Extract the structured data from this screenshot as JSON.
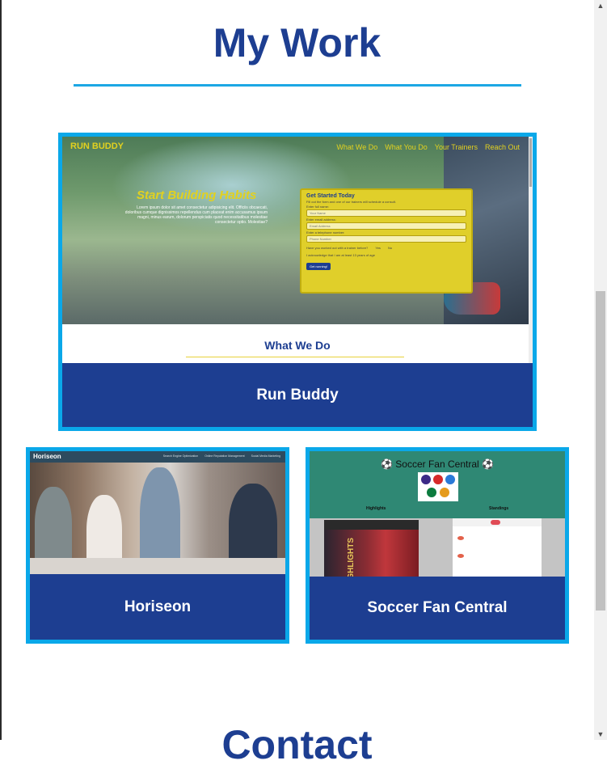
{
  "section": {
    "title": "My Work",
    "next_title": "Contact"
  },
  "colors": {
    "heading": "#1d3e91",
    "accent": "#0aa8e9",
    "card_label_bg": "#1d3e91"
  },
  "projects": [
    {
      "label": "Run Buddy",
      "screenshot": {
        "brand": "RUN BUDDY",
        "nav": [
          "What We Do",
          "What You Do",
          "Your Trainers",
          "Reach Out"
        ],
        "hero_title": "Start Building Habits",
        "hero_text": "Lorem ipsum dolor sit amet consectetur adipisicing elit. Officiis obcaecati, doloribus cumque dignissimos repellendus cum placeat enim accusamus ipsum magni, minus earum, dolorum perspiciatis quod necessitatibus molestiae consectetur optio. Molestiae?",
        "form_title": "Get Started Today",
        "form_sub": "Fill out the form and one of our trainers will schedule a consult.",
        "field_1_label": "Enter full name:",
        "field_1_placeholder": "Your Name",
        "field_2_label": "Enter email address:",
        "field_2_placeholder": "Email Address",
        "field_3_label": "Enter a telephone number:",
        "field_3_placeholder": "Phone Number",
        "radio_question": "Have you worked out with a trainer before?",
        "radio_yes": "Yes",
        "radio_no": "No",
        "checkbox_text": "I acknowledge that I am at least 13 years of age",
        "button": "Get running!",
        "section_title": "What We Do"
      }
    },
    {
      "label": "Horiseon",
      "screenshot": {
        "brand": "Horiseon",
        "nav": [
          "Search Engine Optimization",
          "Online Reputation Management",
          "Social Media Marketing"
        ]
      }
    },
    {
      "label": "Soccer Fan Central",
      "screenshot": {
        "title": "Soccer Fan Central",
        "highlights": "Highlights",
        "standings": "Standings",
        "hl_text": "HIGHLIGHTS"
      }
    }
  ]
}
